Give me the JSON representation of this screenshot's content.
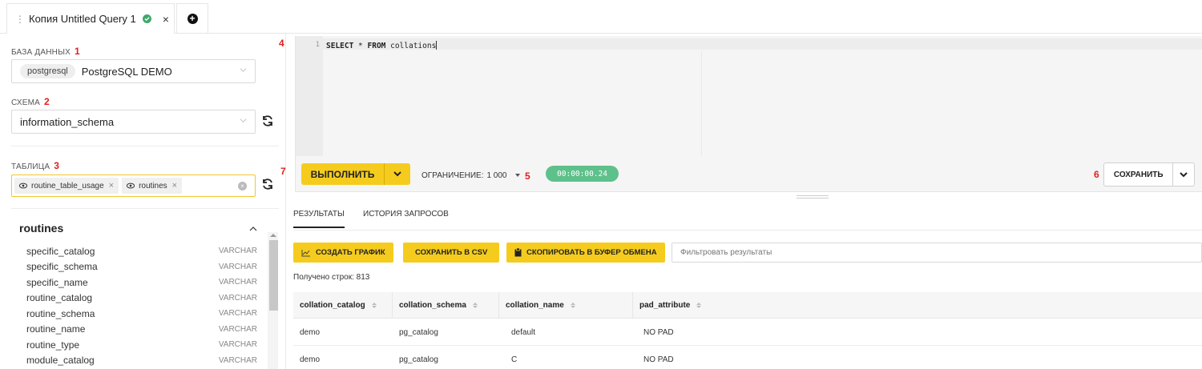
{
  "tab": {
    "title": "Копия Untitled Query 1",
    "close": "×"
  },
  "left": {
    "db_label": "БАЗА ДАННЫХ",
    "db_num": "1",
    "db_pill": "postgresql",
    "db_value": "PostgreSQL DEMO",
    "schema_label": "СХЕМА",
    "schema_num": "2",
    "schema_value": "information_schema",
    "table_label": "ТАБЛИЦА",
    "table_num": "3",
    "tags": [
      "routine_table_usage",
      "routines"
    ],
    "table_name": "routines",
    "columns": [
      {
        "name": "specific_catalog",
        "type": "VARCHAR"
      },
      {
        "name": "specific_schema",
        "type": "VARCHAR"
      },
      {
        "name": "specific_name",
        "type": "VARCHAR"
      },
      {
        "name": "routine_catalog",
        "type": "VARCHAR"
      },
      {
        "name": "routine_schema",
        "type": "VARCHAR"
      },
      {
        "name": "routine_name",
        "type": "VARCHAR"
      },
      {
        "name": "routine_type",
        "type": "VARCHAR"
      },
      {
        "name": "module_catalog",
        "type": "VARCHAR"
      }
    ]
  },
  "markers": {
    "n4": "4",
    "n5": "5",
    "n6": "6",
    "n7": "7"
  },
  "editor": {
    "line": "1",
    "kw1": "SELECT",
    "star": " * ",
    "kw2": "FROM",
    "table": " collations"
  },
  "toolbar": {
    "run_label": "ВЫПОЛНИТЬ",
    "limit_label": "ОГРАНИЧЕНИЕ:",
    "limit_value": "1 000",
    "timer": "00:00:00.24",
    "save_label": "СОХРАНИТЬ"
  },
  "results": {
    "tab_results": "РЕЗУЛЬТАТЫ",
    "tab_history": "ИСТОРИЯ ЗАПРОСОВ",
    "btn_chart": "СОЗДАТЬ ГРАФИК",
    "btn_csv": "СОХРАНИТЬ В CSV",
    "btn_copy": "СКОПИРОВАТЬ В БУФЕР ОБМЕНА",
    "filter_placeholder": "Фильтровать результаты",
    "row_count": "Получено строк: 813",
    "headers": [
      "collation_catalog",
      "collation_schema",
      "collation_name",
      "pad_attribute"
    ],
    "rows": [
      [
        "demo",
        "pg_catalog",
        "default",
        "NO PAD"
      ],
      [
        "demo",
        "pg_catalog",
        "C",
        "NO PAD"
      ]
    ]
  },
  "colors": {
    "accent": "#f5cc1e",
    "success": "#5ec08b",
    "marker": "#e02020"
  }
}
